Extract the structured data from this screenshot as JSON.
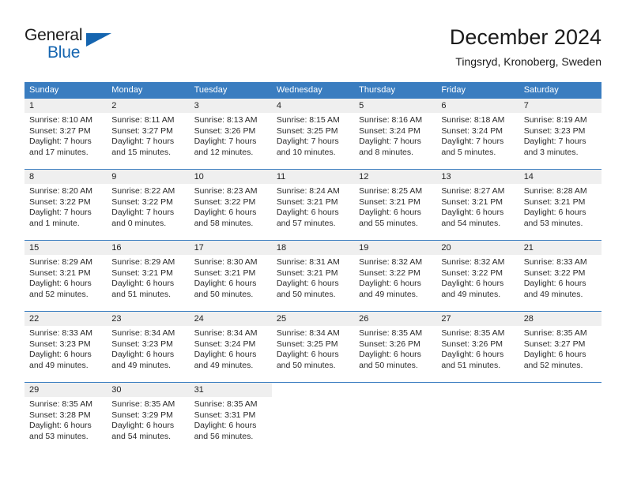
{
  "brand": {
    "name_part1": "General",
    "name_part2": "Blue",
    "accent_color": "#1565b0",
    "logo_icon": "triangle-flag-icon"
  },
  "header": {
    "title": "December 2024",
    "subtitle": "Tingsryd, Kronoberg, Sweden"
  },
  "calendar": {
    "header_bg": "#3a7dc0",
    "daynum_bg": "#efefef",
    "weekdays": [
      "Sunday",
      "Monday",
      "Tuesday",
      "Wednesday",
      "Thursday",
      "Friday",
      "Saturday"
    ],
    "weeks": [
      [
        {
          "day": "1",
          "sunrise": "Sunrise: 8:10 AM",
          "sunset": "Sunset: 3:27 PM",
          "daylight1": "Daylight: 7 hours",
          "daylight2": "and 17 minutes."
        },
        {
          "day": "2",
          "sunrise": "Sunrise: 8:11 AM",
          "sunset": "Sunset: 3:27 PM",
          "daylight1": "Daylight: 7 hours",
          "daylight2": "and 15 minutes."
        },
        {
          "day": "3",
          "sunrise": "Sunrise: 8:13 AM",
          "sunset": "Sunset: 3:26 PM",
          "daylight1": "Daylight: 7 hours",
          "daylight2": "and 12 minutes."
        },
        {
          "day": "4",
          "sunrise": "Sunrise: 8:15 AM",
          "sunset": "Sunset: 3:25 PM",
          "daylight1": "Daylight: 7 hours",
          "daylight2": "and 10 minutes."
        },
        {
          "day": "5",
          "sunrise": "Sunrise: 8:16 AM",
          "sunset": "Sunset: 3:24 PM",
          "daylight1": "Daylight: 7 hours",
          "daylight2": "and 8 minutes."
        },
        {
          "day": "6",
          "sunrise": "Sunrise: 8:18 AM",
          "sunset": "Sunset: 3:24 PM",
          "daylight1": "Daylight: 7 hours",
          "daylight2": "and 5 minutes."
        },
        {
          "day": "7",
          "sunrise": "Sunrise: 8:19 AM",
          "sunset": "Sunset: 3:23 PM",
          "daylight1": "Daylight: 7 hours",
          "daylight2": "and 3 minutes."
        }
      ],
      [
        {
          "day": "8",
          "sunrise": "Sunrise: 8:20 AM",
          "sunset": "Sunset: 3:22 PM",
          "daylight1": "Daylight: 7 hours",
          "daylight2": "and 1 minute."
        },
        {
          "day": "9",
          "sunrise": "Sunrise: 8:22 AM",
          "sunset": "Sunset: 3:22 PM",
          "daylight1": "Daylight: 7 hours",
          "daylight2": "and 0 minutes."
        },
        {
          "day": "10",
          "sunrise": "Sunrise: 8:23 AM",
          "sunset": "Sunset: 3:22 PM",
          "daylight1": "Daylight: 6 hours",
          "daylight2": "and 58 minutes."
        },
        {
          "day": "11",
          "sunrise": "Sunrise: 8:24 AM",
          "sunset": "Sunset: 3:21 PM",
          "daylight1": "Daylight: 6 hours",
          "daylight2": "and 57 minutes."
        },
        {
          "day": "12",
          "sunrise": "Sunrise: 8:25 AM",
          "sunset": "Sunset: 3:21 PM",
          "daylight1": "Daylight: 6 hours",
          "daylight2": "and 55 minutes."
        },
        {
          "day": "13",
          "sunrise": "Sunrise: 8:27 AM",
          "sunset": "Sunset: 3:21 PM",
          "daylight1": "Daylight: 6 hours",
          "daylight2": "and 54 minutes."
        },
        {
          "day": "14",
          "sunrise": "Sunrise: 8:28 AM",
          "sunset": "Sunset: 3:21 PM",
          "daylight1": "Daylight: 6 hours",
          "daylight2": "and 53 minutes."
        }
      ],
      [
        {
          "day": "15",
          "sunrise": "Sunrise: 8:29 AM",
          "sunset": "Sunset: 3:21 PM",
          "daylight1": "Daylight: 6 hours",
          "daylight2": "and 52 minutes."
        },
        {
          "day": "16",
          "sunrise": "Sunrise: 8:29 AM",
          "sunset": "Sunset: 3:21 PM",
          "daylight1": "Daylight: 6 hours",
          "daylight2": "and 51 minutes."
        },
        {
          "day": "17",
          "sunrise": "Sunrise: 8:30 AM",
          "sunset": "Sunset: 3:21 PM",
          "daylight1": "Daylight: 6 hours",
          "daylight2": "and 50 minutes."
        },
        {
          "day": "18",
          "sunrise": "Sunrise: 8:31 AM",
          "sunset": "Sunset: 3:21 PM",
          "daylight1": "Daylight: 6 hours",
          "daylight2": "and 50 minutes."
        },
        {
          "day": "19",
          "sunrise": "Sunrise: 8:32 AM",
          "sunset": "Sunset: 3:22 PM",
          "daylight1": "Daylight: 6 hours",
          "daylight2": "and 49 minutes."
        },
        {
          "day": "20",
          "sunrise": "Sunrise: 8:32 AM",
          "sunset": "Sunset: 3:22 PM",
          "daylight1": "Daylight: 6 hours",
          "daylight2": "and 49 minutes."
        },
        {
          "day": "21",
          "sunrise": "Sunrise: 8:33 AM",
          "sunset": "Sunset: 3:22 PM",
          "daylight1": "Daylight: 6 hours",
          "daylight2": "and 49 minutes."
        }
      ],
      [
        {
          "day": "22",
          "sunrise": "Sunrise: 8:33 AM",
          "sunset": "Sunset: 3:23 PM",
          "daylight1": "Daylight: 6 hours",
          "daylight2": "and 49 minutes."
        },
        {
          "day": "23",
          "sunrise": "Sunrise: 8:34 AM",
          "sunset": "Sunset: 3:23 PM",
          "daylight1": "Daylight: 6 hours",
          "daylight2": "and 49 minutes."
        },
        {
          "day": "24",
          "sunrise": "Sunrise: 8:34 AM",
          "sunset": "Sunset: 3:24 PM",
          "daylight1": "Daylight: 6 hours",
          "daylight2": "and 49 minutes."
        },
        {
          "day": "25",
          "sunrise": "Sunrise: 8:34 AM",
          "sunset": "Sunset: 3:25 PM",
          "daylight1": "Daylight: 6 hours",
          "daylight2": "and 50 minutes."
        },
        {
          "day": "26",
          "sunrise": "Sunrise: 8:35 AM",
          "sunset": "Sunset: 3:26 PM",
          "daylight1": "Daylight: 6 hours",
          "daylight2": "and 50 minutes."
        },
        {
          "day": "27",
          "sunrise": "Sunrise: 8:35 AM",
          "sunset": "Sunset: 3:26 PM",
          "daylight1": "Daylight: 6 hours",
          "daylight2": "and 51 minutes."
        },
        {
          "day": "28",
          "sunrise": "Sunrise: 8:35 AM",
          "sunset": "Sunset: 3:27 PM",
          "daylight1": "Daylight: 6 hours",
          "daylight2": "and 52 minutes."
        }
      ],
      [
        {
          "day": "29",
          "sunrise": "Sunrise: 8:35 AM",
          "sunset": "Sunset: 3:28 PM",
          "daylight1": "Daylight: 6 hours",
          "daylight2": "and 53 minutes."
        },
        {
          "day": "30",
          "sunrise": "Sunrise: 8:35 AM",
          "sunset": "Sunset: 3:29 PM",
          "daylight1": "Daylight: 6 hours",
          "daylight2": "and 54 minutes."
        },
        {
          "day": "31",
          "sunrise": "Sunrise: 8:35 AM",
          "sunset": "Sunset: 3:31 PM",
          "daylight1": "Daylight: 6 hours",
          "daylight2": "and 56 minutes."
        },
        {
          "day": "",
          "sunrise": "",
          "sunset": "",
          "daylight1": "",
          "daylight2": ""
        },
        {
          "day": "",
          "sunrise": "",
          "sunset": "",
          "daylight1": "",
          "daylight2": ""
        },
        {
          "day": "",
          "sunrise": "",
          "sunset": "",
          "daylight1": "",
          "daylight2": ""
        },
        {
          "day": "",
          "sunrise": "",
          "sunset": "",
          "daylight1": "",
          "daylight2": ""
        }
      ]
    ]
  }
}
